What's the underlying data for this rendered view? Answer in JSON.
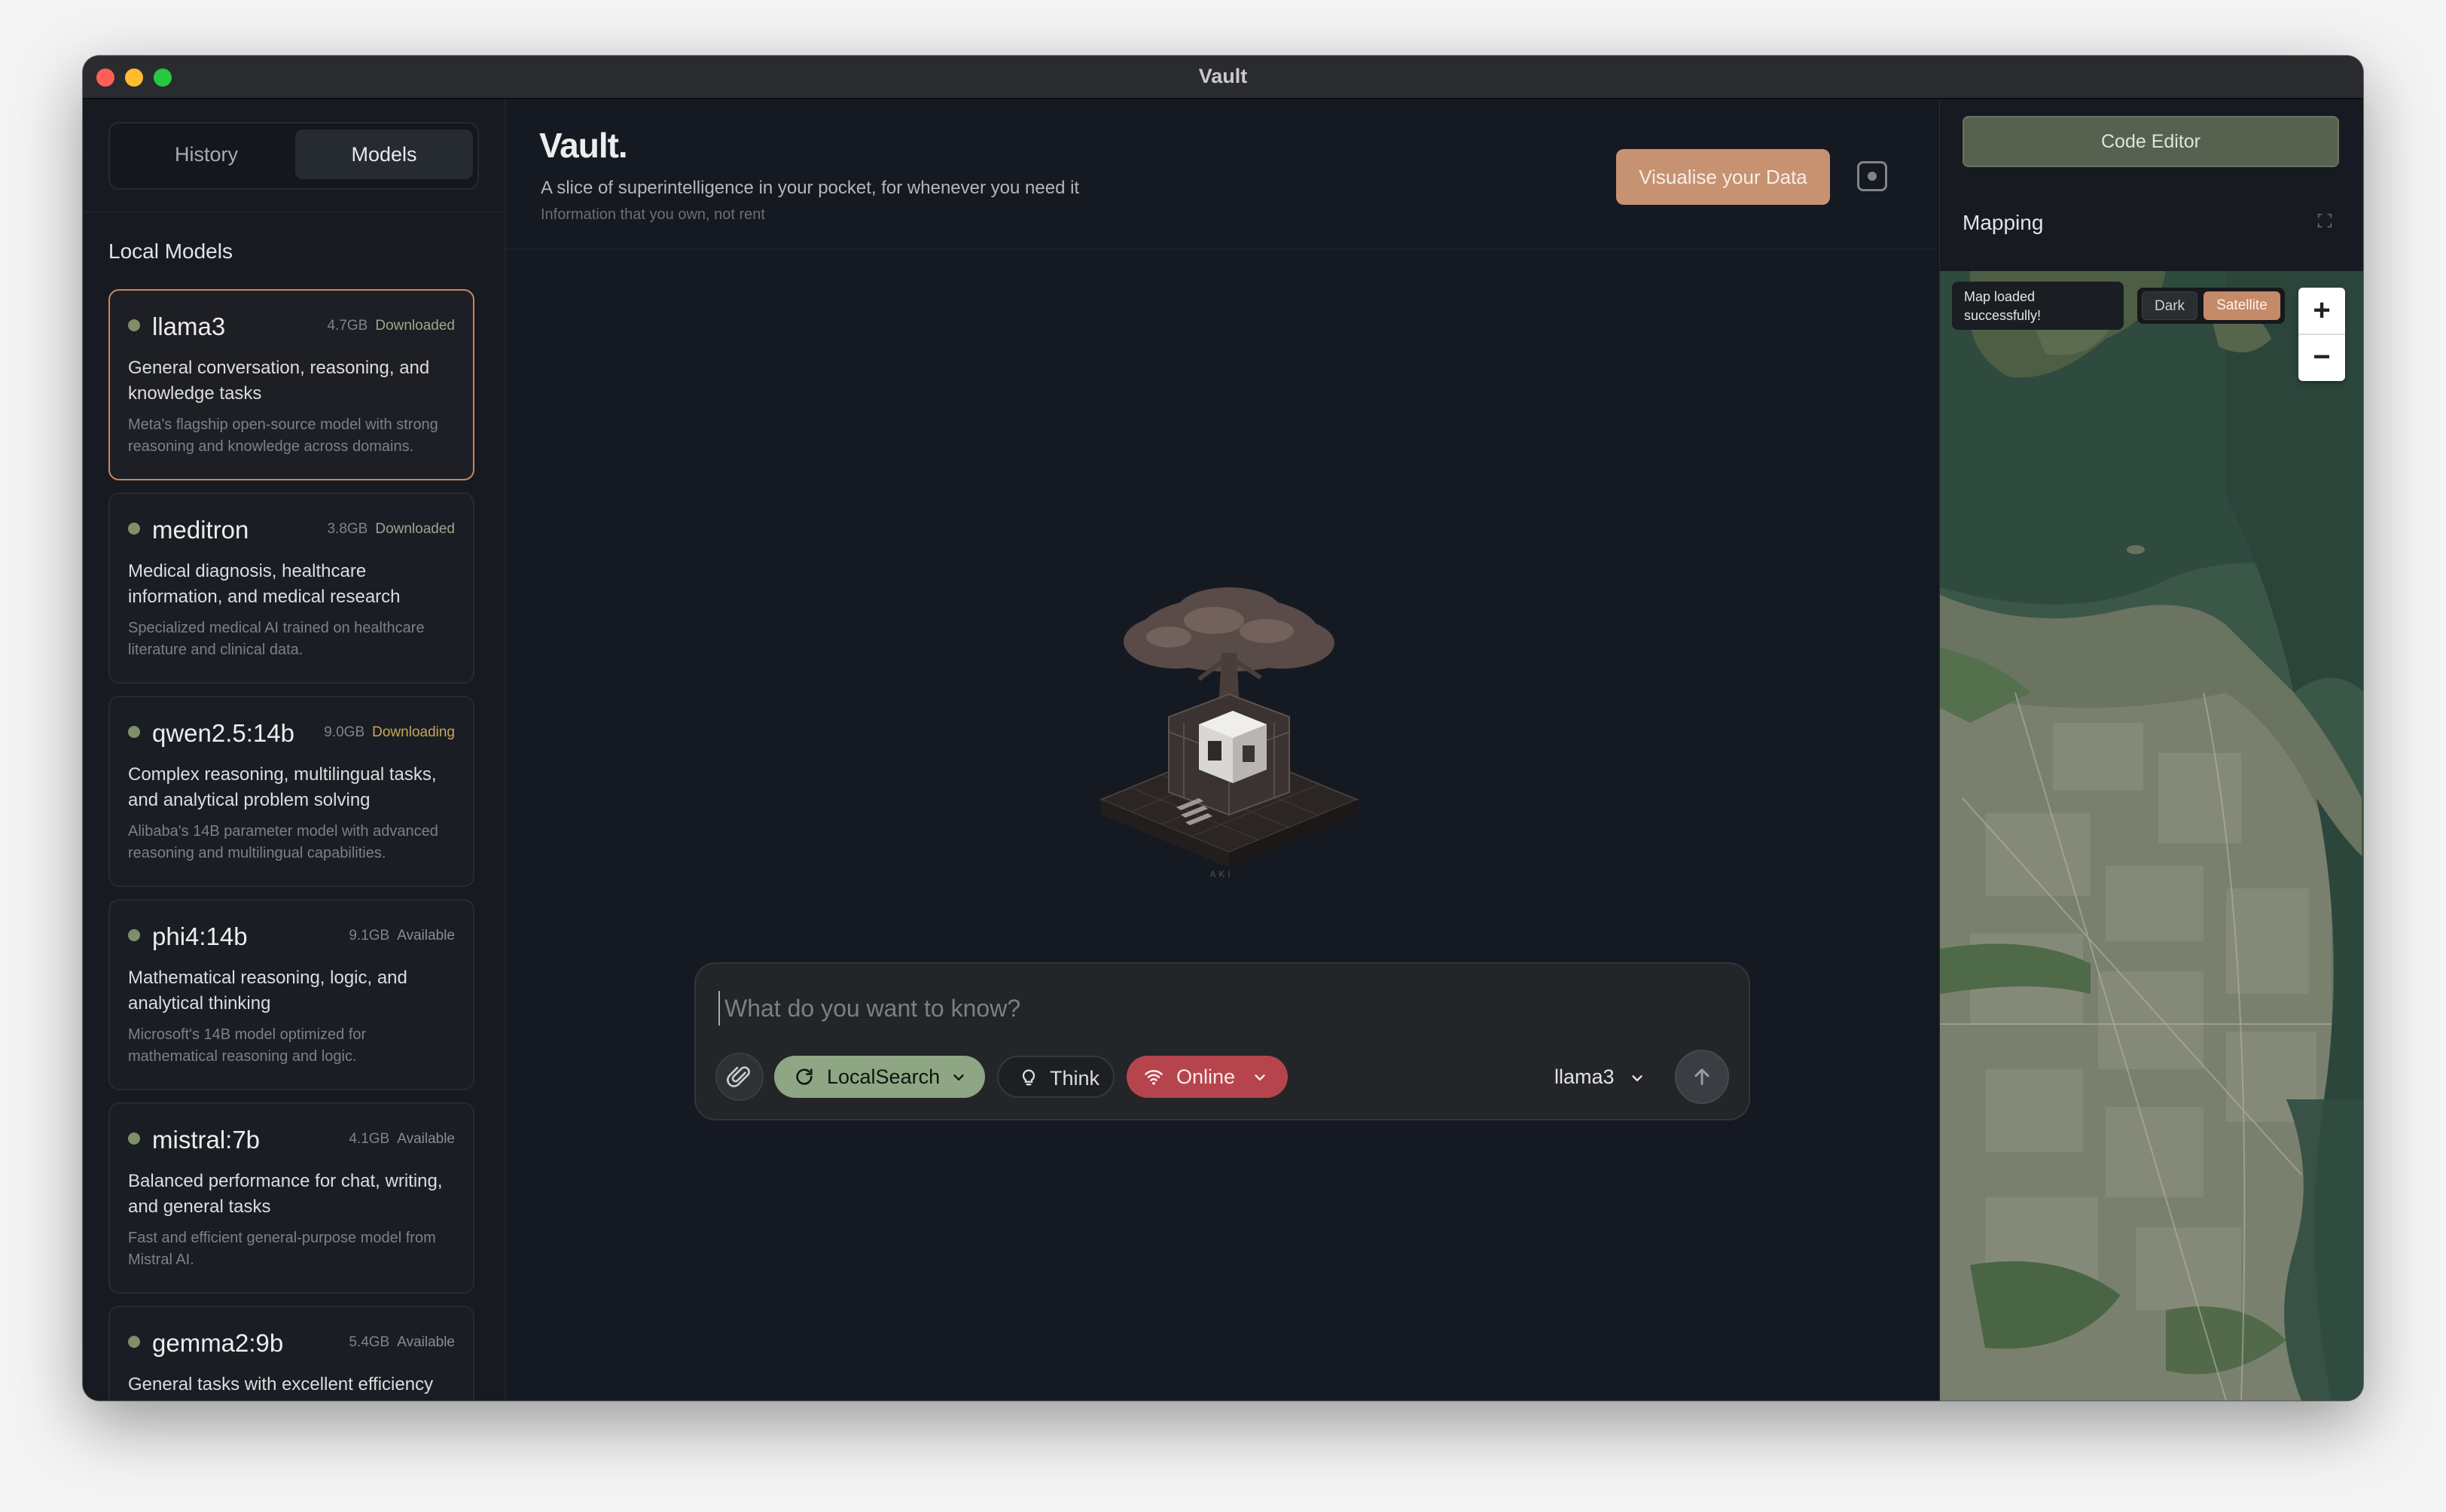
{
  "window": {
    "title": "Vault"
  },
  "sidebar": {
    "tabs": [
      {
        "label": "History",
        "active": false
      },
      {
        "label": "Models",
        "active": true
      }
    ],
    "section_title": "Local Models",
    "models": [
      {
        "name": "llama3",
        "size": "4.7GB",
        "status": "Downloaded",
        "description": "General conversation, reasoning, and knowledge tasks",
        "detail": "Meta's flagship open-source model with strong reasoning and knowledge across domains.",
        "selected": true
      },
      {
        "name": "meditron",
        "size": "3.8GB",
        "status": "Downloaded",
        "description": "Medical diagnosis, healthcare information, and medical research",
        "detail": "Specialized medical AI trained on healthcare literature and clinical data."
      },
      {
        "name": "qwen2.5:14b",
        "size": "9.0GB",
        "status": "Downloading",
        "description": "Complex reasoning, multilingual tasks, and analytical problem solving",
        "detail": "Alibaba's 14B parameter model with advanced reasoning and multilingual capabilities."
      },
      {
        "name": "phi4:14b",
        "size": "9.1GB",
        "status": "Available",
        "description": "Mathematical reasoning, logic, and analytical thinking",
        "detail": "Microsoft's 14B model optimized for mathematical reasoning and logic."
      },
      {
        "name": "mistral:7b",
        "size": "4.1GB",
        "status": "Available",
        "description": "Balanced performance for chat, writing, and general tasks",
        "detail": "Fast and efficient general-purpose model from Mistral AI."
      },
      {
        "name": "gemma2:9b",
        "size": "5.4GB",
        "status": "Available",
        "description": "General tasks with excellent efficiency",
        "detail": ""
      }
    ]
  },
  "main": {
    "brand": "Vault.",
    "tagline": "A slice of superintelligence in your pocket, for whenever you need it",
    "subtagline": "Information that you own, not rent",
    "visualise_button": "Visualise your Data",
    "record_icon": "record-icon",
    "illustration_caption": "AKI",
    "prompt": {
      "placeholder": "What do you want to know?",
      "value": "",
      "attach_icon": "paperclip-icon",
      "local_search": "LocalSearch",
      "think": "Think",
      "online": "Online",
      "model": "llama3",
      "send_icon": "arrow-up-icon"
    }
  },
  "right_panel": {
    "code_editor_button": "Code Editor",
    "mapping_title": "Mapping",
    "map": {
      "toast": "Map loaded successfully!",
      "style_dark": "Dark",
      "style_satellite": "Satellite",
      "active_style": "Satellite",
      "zoom_in": "+",
      "zoom_out": "−"
    }
  },
  "colors": {
    "accent": "#c79271",
    "local_search": "#8ea683",
    "online": "#b6444c",
    "code_editor": "#56624f"
  }
}
